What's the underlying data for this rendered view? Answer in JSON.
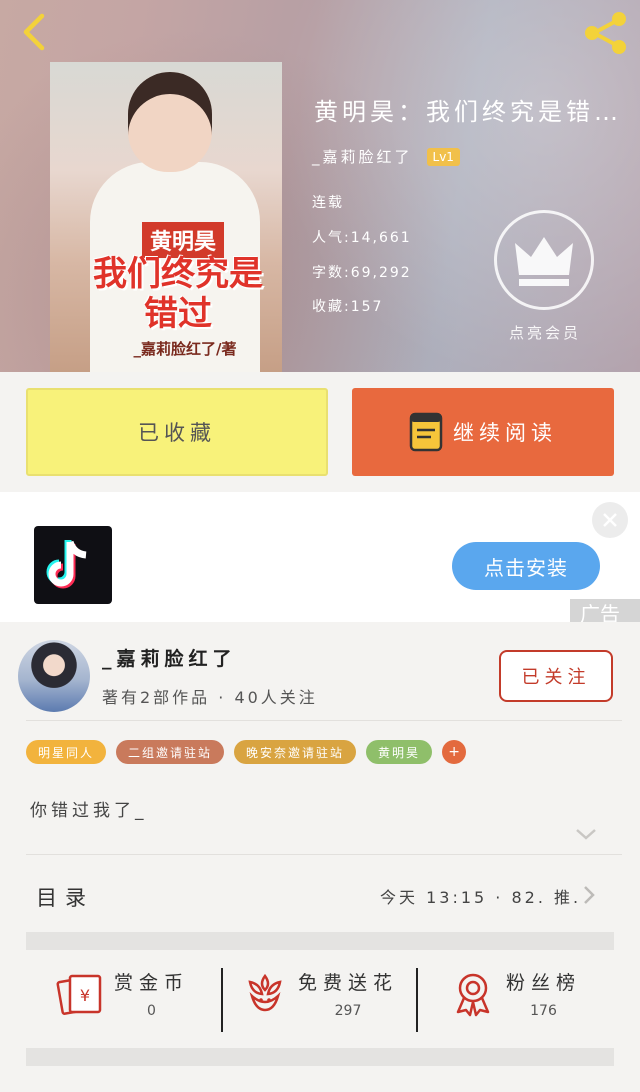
{
  "header": {
    "book_title": "黄明昊：我们终究是错…",
    "author": "_嘉莉脸红了",
    "level": "Lv1",
    "status": "连载",
    "popularity": "人气:14,661",
    "word_count": "字数:69,292",
    "favorites": "收藏:157",
    "vip_label": "点亮会员"
  },
  "cover": {
    "tag": "黄明昊",
    "title": "我们终究是错过",
    "author": "_嘉莉脸红了/著"
  },
  "actions": {
    "collected_label": "已收藏",
    "continue_label": "继续阅读"
  },
  "ad": {
    "install_label": "点击安装",
    "ad_label": "广告"
  },
  "author_section": {
    "name": "_嘉莉脸红了",
    "summary": "著有2部作品 · 40人关注",
    "follow_label": "已关注"
  },
  "tags": [
    {
      "label": "明星同人",
      "color": "#f2b33d"
    },
    {
      "label": "二组邀请驻站",
      "color": "#c97a5c"
    },
    {
      "label": "晚安奈邀请驻站",
      "color": "#d9a441"
    },
    {
      "label": "黄明昊",
      "color": "#8fbf6a"
    }
  ],
  "tag_more": "+",
  "intro": "你错过我了_",
  "toc": {
    "label": "目录",
    "latest": "今天 13:15 · 82. 推."
  },
  "rewards": [
    {
      "title": "赏金币",
      "count": "0",
      "icon": "red-envelope-icon"
    },
    {
      "title": "免费送花",
      "count": "297",
      "icon": "flower-icon"
    },
    {
      "title": "粉丝榜",
      "count": "176",
      "icon": "award-ribbon-icon"
    }
  ],
  "colors": {
    "accent_orange": "#e8693e",
    "collect_yellow": "#f8f27a",
    "follow_red": "#c33b2a",
    "install_blue": "#5aa7ee"
  }
}
